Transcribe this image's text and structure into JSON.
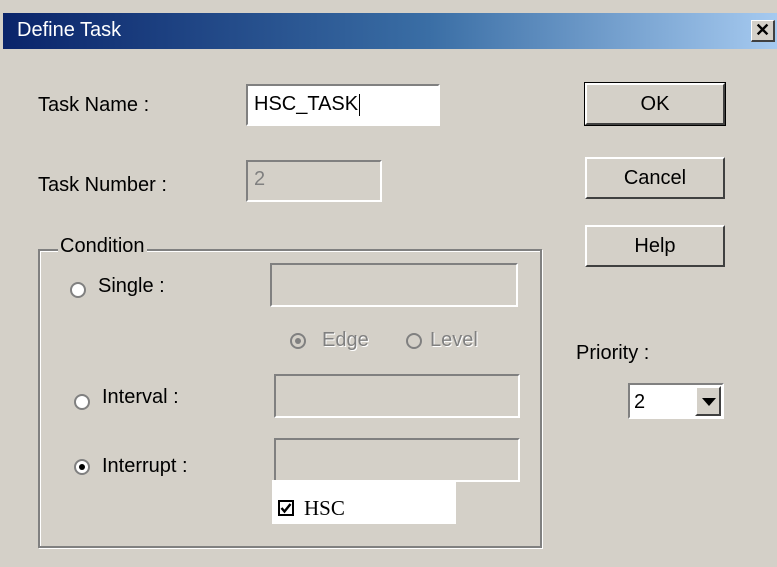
{
  "window": {
    "title": "Define Task",
    "close_glyph": "✕"
  },
  "form": {
    "task_name_label": "Task Name :",
    "task_name_value": "HSC_TASK",
    "task_number_label": "Task Number :",
    "task_number_value": "2"
  },
  "buttons": {
    "ok": "OK",
    "cancel": "Cancel",
    "help": "Help"
  },
  "condition": {
    "group_label": "Condition",
    "single_label": "Single :",
    "single_selected": false,
    "edge_label": "Edge",
    "edge_selected": true,
    "level_label": "Level",
    "level_selected": false,
    "interval_label": "Interval :",
    "interval_selected": false,
    "interrupt_label": "Interrupt :",
    "interrupt_selected": true,
    "hsc_label": "HSC",
    "hsc_checked": true
  },
  "priority": {
    "label": "Priority :",
    "value": "2"
  }
}
